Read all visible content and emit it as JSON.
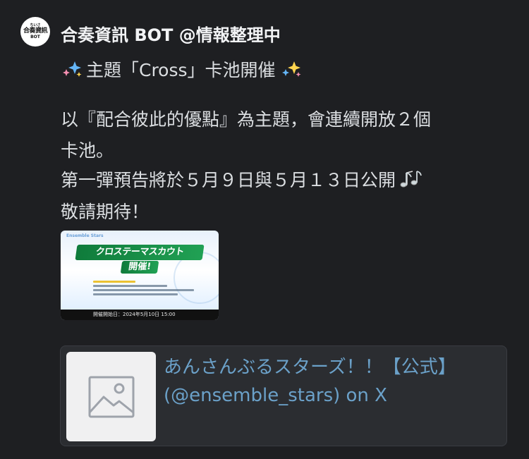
{
  "author": {
    "avatar_text": [
      "ちいさ",
      "合奏資訊",
      "BOT"
    ],
    "username": "合奏資訊 BOT @情報整理中"
  },
  "message": {
    "title_text": "主題「Cross」卡池開催",
    "title_emoji": "sparkles-icon",
    "line1": "以『配合彼此的優點』為主題，會連續開放２個",
    "line2": "卡池。",
    "line3": "第一彈預告將於５月９日與５月１３日公開",
    "line3_emoji": "musical-notes-icon",
    "line4": "敬請期待！"
  },
  "attachment": {
    "corner_text": "Ensemble Stars",
    "headline": "クロステーマスカウト",
    "headline2": "開催!",
    "date_text": "開催開始日：2024年5月10日 15:00"
  },
  "embed": {
    "thumbnail_icon": "image-placeholder-icon",
    "link_title": "あんさんぶるスターズ！！【公式】 (@ensemble_stars) on X",
    "link_color": "#6ba1c9"
  },
  "colors": {
    "background": "#1e1f22",
    "text": "#dbdee1",
    "username": "#f2f3f5",
    "embed_bg": "#2b2d31"
  }
}
